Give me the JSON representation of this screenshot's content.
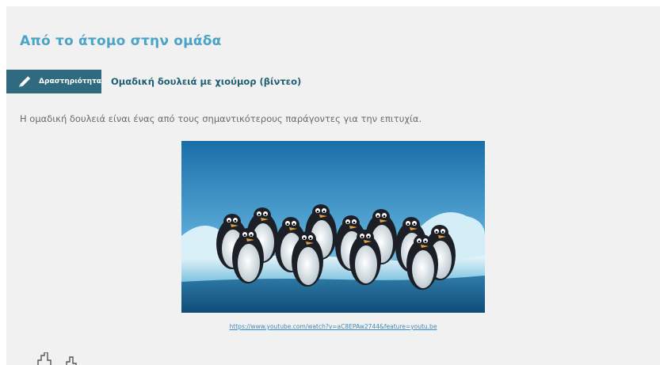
{
  "page": {
    "title": "Από το άτομο στην ομάδα"
  },
  "activity": {
    "badge_label": "Δραστηριότητα",
    "badge_icon": "pencil-icon",
    "title": "Ομαδική δουλειά με χιούμορ (βίντεο)"
  },
  "intro_text": "Η ομαδική δουλειά είναι ένας από τους σημαντικότερους παράγοντες για την επιτυχία.",
  "video": {
    "link_text": "https://www.youtube.com/watch?v=aC8EPAw2744&feature=youtu.be"
  },
  "colors": {
    "title": "#4ba3c7",
    "badge_bg": "#2f6a7f",
    "activity_title": "#1f5f73",
    "link": "#3a8bc0",
    "page_bg": "#f1f1f1"
  },
  "bottom_icon": "bar-chart-icon"
}
